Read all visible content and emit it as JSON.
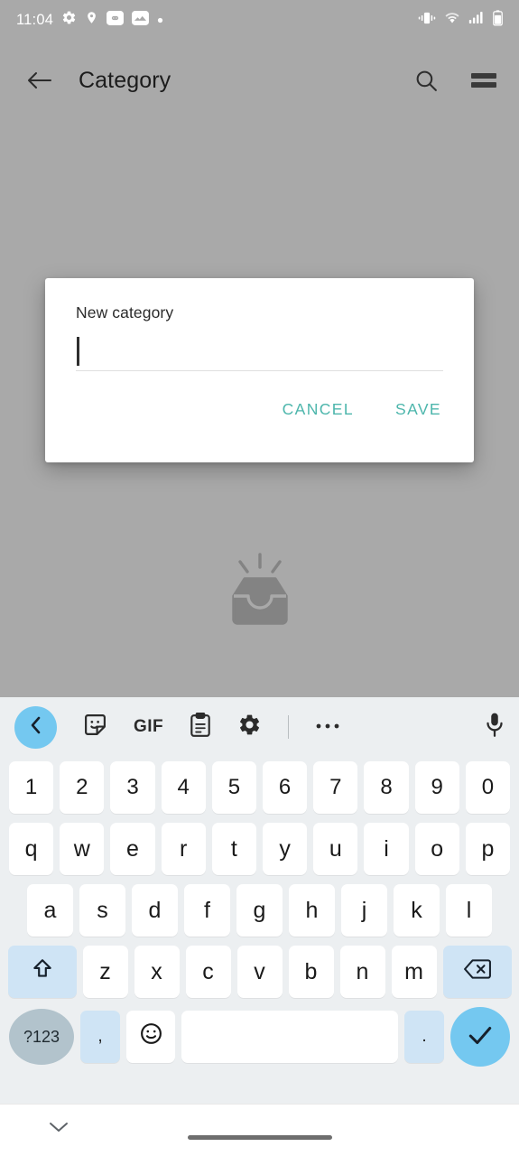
{
  "status_bar": {
    "time": "11:04",
    "left_icons": [
      "gear-icon",
      "location-pin-icon",
      "link-badge-icon",
      "image-icon",
      "dot-icon"
    ],
    "right_icons": [
      "vibrate-icon",
      "wifi-icon",
      "signal-icon",
      "battery-icon"
    ]
  },
  "app_bar": {
    "back_icon": "arrow-left-icon",
    "title": "Category",
    "search_icon": "search-icon",
    "menu_icon": "list-menu-icon"
  },
  "empty_state": {
    "icon": "empty-inbox-icon"
  },
  "dialog": {
    "label": "New category",
    "input_value": "",
    "input_placeholder": "",
    "cancel_label": "CANCEL",
    "save_label": "SAVE",
    "accent_color": "#4db6ac"
  },
  "keyboard": {
    "accent_color": "#74c8f0",
    "background_color": "#eceff1",
    "toolbar": {
      "back_icon": "chevron-left-icon",
      "sticker_icon": "sticker-icon",
      "gif_label": "GIF",
      "clipboard_icon": "clipboard-icon",
      "settings_icon": "gear-icon",
      "more_icon": "more-horizontal-icon",
      "mic_icon": "microphone-icon"
    },
    "rows": {
      "numbers": [
        "1",
        "2",
        "3",
        "4",
        "5",
        "6",
        "7",
        "8",
        "9",
        "0"
      ],
      "top": [
        "q",
        "w",
        "e",
        "r",
        "t",
        "y",
        "u",
        "i",
        "o",
        "p"
      ],
      "home": [
        "a",
        "s",
        "d",
        "f",
        "g",
        "h",
        "j",
        "k",
        "l"
      ],
      "bottom": [
        "z",
        "x",
        "c",
        "v",
        "b",
        "n",
        "m"
      ]
    },
    "shift_icon": "shift-up-icon",
    "backspace_icon": "backspace-icon",
    "symbols_label": "?123",
    "comma_label": ",",
    "emoji_icon": "emoji-smiley-icon",
    "space_label": "",
    "period_label": ".",
    "enter_icon": "checkmark-icon"
  },
  "nav_bar": {
    "hide_keyboard_icon": "chevron-down-icon",
    "home_indicator": "home-indicator"
  }
}
